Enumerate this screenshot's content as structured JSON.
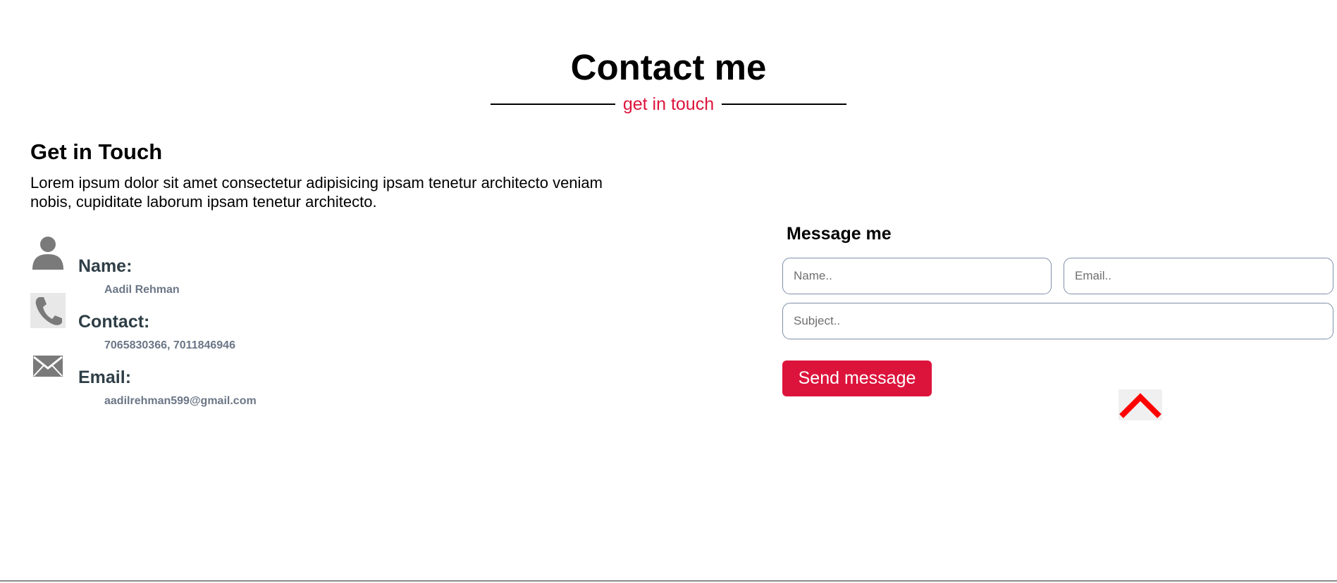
{
  "header": {
    "title": "Contact me",
    "subtitle": "get in touch"
  },
  "intro": {
    "heading": "Get in Touch",
    "paragraph": "Lorem ipsum dolor sit amet consectetur adipisicing ipsam tenetur architecto veniam nobis, cupiditate laborum ipsam tenetur architecto."
  },
  "info": [
    {
      "icon": "person-icon",
      "label": "Name:",
      "value": "Aadil Rehman"
    },
    {
      "icon": "phone-icon",
      "label": "Contact:",
      "value": "7065830366, 7011846946"
    },
    {
      "icon": "mail-icon",
      "label": "Email:",
      "value": "aadilrehman599@gmail.com"
    }
  ],
  "form": {
    "heading": "Message me",
    "name_placeholder": "Name..",
    "email_placeholder": "Email..",
    "subject_placeholder": "Subject..",
    "send_label": "Send message"
  },
  "scroll_top": {
    "icon": "chevron-up-icon"
  },
  "colors": {
    "accent": "#dc143c",
    "label": "#2f3e46",
    "value": "#6b7686",
    "icon": "#7a7a7a",
    "scroll_arrow": "#ff0000"
  }
}
